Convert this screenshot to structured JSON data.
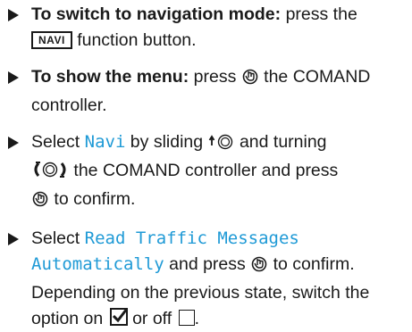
{
  "steps": [
    {
      "heading": "To switch to navigation mode:",
      "text_a": " press the",
      "key": "NAVI",
      "text_b": " function button."
    },
    {
      "heading": "To show the menu:",
      "text_a": " press ",
      "text_b": " the COMAND controller."
    },
    {
      "text_a": "Select ",
      "menu_item": "Navi",
      "text_b": " by sliding ",
      "text_c": " and turning",
      "text_d": " the COMAND controller and press",
      "text_e": " to confirm."
    },
    {
      "text_a": "Select ",
      "menu_item": "Read Traffic Messages Automatically",
      "text_b": " and press ",
      "text_c": " to confirm. Depending on the previous state, switch the option on ",
      "text_d": " or off ",
      "text_e": "."
    }
  ],
  "icons": {
    "press": "controller-press-icon",
    "slide_up": "slide-up-icon",
    "turn": "turn-icon",
    "checked": "checkbox-checked-icon",
    "unchecked": "checkbox-unchecked-icon"
  },
  "colors": {
    "text": "#1a1a1a",
    "menu_item": "#1f9ad6"
  }
}
